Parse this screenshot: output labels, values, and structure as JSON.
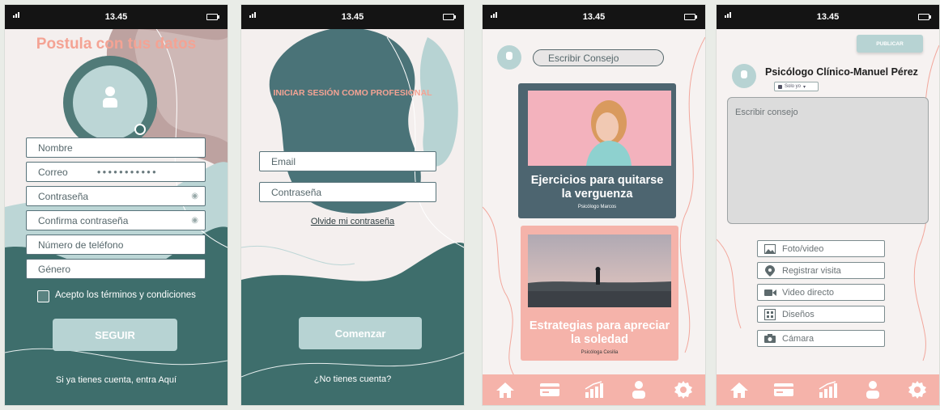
{
  "status": {
    "time": "13.45"
  },
  "screen1": {
    "title": "Postula con tus datos",
    "fields": [
      {
        "placeholder": "Nombre"
      },
      {
        "placeholder": "Correo",
        "value": "●●●●●●●●●●●"
      },
      {
        "placeholder": "Contraseña"
      },
      {
        "placeholder": "Confirma contraseña"
      },
      {
        "placeholder": "Número de teléfono"
      },
      {
        "placeholder": "Género"
      }
    ],
    "terms_label": "Acepto los términos y condiciones",
    "continue_label": "SEGUIR",
    "login_link": "Si ya tienes cuenta, entra Aquí"
  },
  "screen2": {
    "title": "INICIAR SESIÓN COMO PROFESIONAL",
    "email_placeholder": "Email",
    "password_placeholder": "Contraseña",
    "forgot_link": "Olvide mi contraseña",
    "start_label": "Comenzar",
    "signup_link": "¿No tienes cuenta?"
  },
  "screen3": {
    "search_placeholder": "Escribir Consejo",
    "cards": [
      {
        "title": "Ejercicios para quitarse la verguenza",
        "author": "Psicólogo Marcos"
      },
      {
        "title": "Estrategias para apreciar la soledad",
        "author": "Psicóloga Cesilia"
      }
    ]
  },
  "screen4": {
    "publish_label": "PUBLICAR",
    "profile_name": "Psicólogo Clínico-Manuel Pérez",
    "privacy_label": "Solo yo",
    "editor_placeholder": "Escribir consejo",
    "options": [
      {
        "label": "Foto/video",
        "icon": "photo-icon"
      },
      {
        "label": "Registrar visita",
        "icon": "location-pin-icon"
      },
      {
        "label": "Video directo",
        "icon": "video-camera-icon"
      },
      {
        "label": "Diseños",
        "icon": "layout-icon"
      },
      {
        "label": "Cámara",
        "icon": "camera-icon"
      }
    ]
  },
  "tabbar": [
    "home-icon",
    "card-icon",
    "stats-icon",
    "profile-icon",
    "settings-icon"
  ],
  "colors": {
    "teal_dark": "#3e6e6c",
    "teal_light": "#b7d3d3",
    "salmon": "#f5b3aa",
    "slate": "#4d6570"
  }
}
